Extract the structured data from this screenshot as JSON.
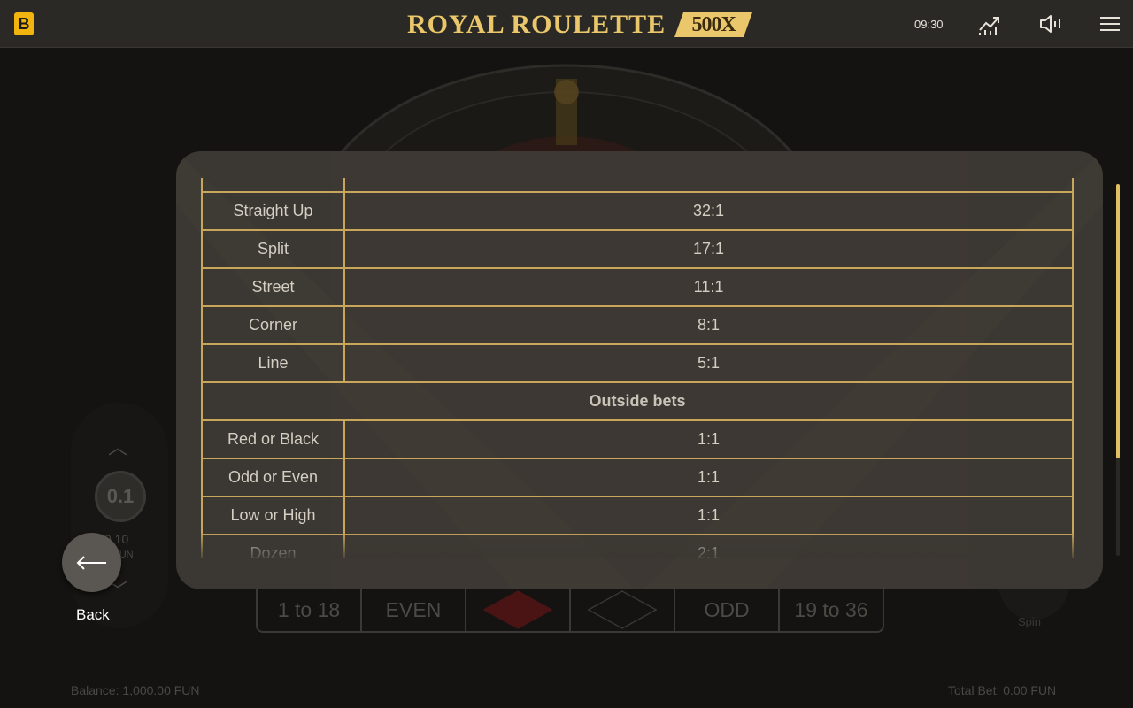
{
  "header": {
    "brand_letter": "B",
    "title": "ROYAL ROULETTE",
    "title_badge": "500X",
    "clock": "09:30",
    "icons": [
      "stats-icon",
      "sound-icon",
      "menu-icon"
    ]
  },
  "background": {
    "chip_value": "0.1",
    "bet_value": "0.10",
    "bet_currency": "FUN",
    "outside_bets": [
      "1 to 18",
      "EVEN",
      "",
      "",
      "ODD",
      "19 to 36"
    ],
    "balance": "Balance: 1,000.00 FUN",
    "total_bet": "Total Bet: 0.00 FUN",
    "spin_label": "Spin"
  },
  "back": {
    "label": "Back"
  },
  "paytable": {
    "rows": [
      {
        "bet": "Straight Up",
        "payout": "32:1"
      },
      {
        "bet": "Split",
        "payout": "17:1"
      },
      {
        "bet": "Street",
        "payout": "11:1"
      },
      {
        "bet": "Corner",
        "payout": "8:1"
      },
      {
        "bet": "Line",
        "payout": "5:1"
      }
    ],
    "outside_header": "Outside bets",
    "outside_rows": [
      {
        "bet": "Red or Black",
        "payout": "1:1"
      },
      {
        "bet": "Odd or Even",
        "payout": "1:1"
      },
      {
        "bet": "Low or High",
        "payout": "1:1"
      },
      {
        "bet": "Dozen",
        "payout": "2:1"
      }
    ]
  },
  "colors": {
    "accent_gold": "#e1be62",
    "table_border": "#c9a75a",
    "modal_bg": "#3b3732",
    "topbar_bg": "#2b2926",
    "brand_yellow": "#f2b50f"
  }
}
